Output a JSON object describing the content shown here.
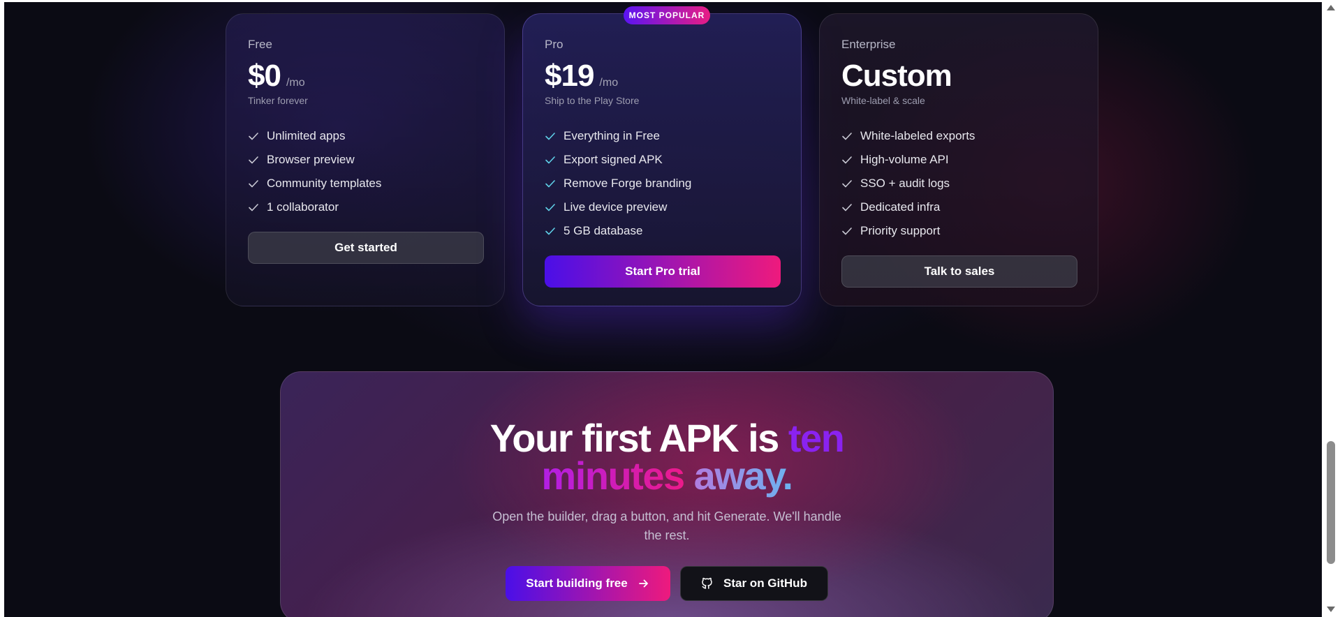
{
  "pricing": {
    "plans": [
      {
        "name": "Free",
        "price": "$0",
        "period": "/mo",
        "subtitle": "Tinker forever",
        "features": [
          "Unlimited apps",
          "Browser preview",
          "Community templates",
          "1 collaborator"
        ],
        "cta": "Get started"
      },
      {
        "name": "Pro",
        "badge": "MOST POPULAR",
        "price": "$19",
        "period": "/mo",
        "subtitle": "Ship to the Play Store",
        "features": [
          "Everything in Free",
          "Export signed APK",
          "Remove Forge branding",
          "Live device preview",
          "5 GB database"
        ],
        "cta": "Start Pro trial"
      },
      {
        "name": "Enterprise",
        "price": "Custom",
        "subtitle": "White-label & scale",
        "features": [
          "White-labeled exports",
          "High-volume API",
          "SSO + audit logs",
          "Dedicated infra",
          "Priority support"
        ],
        "cta": "Talk to sales"
      }
    ]
  },
  "cta": {
    "heading_start": "Your first APK is",
    "heading_ten": "ten",
    "heading_minutes": "minutes",
    "heading_away": "away.",
    "subtext": "Open the builder, drag a button, and hit Generate. We'll handle the rest.",
    "primary_button": "Start building free",
    "secondary_button": "Star on GitHub"
  },
  "icons": {
    "feature_check": "check-icon",
    "primary_button_icon": "arrow-right-icon",
    "secondary_button_icon": "github-icon"
  },
  "colors": {
    "accent_start": "#4a0fe8",
    "accent_end": "#ee1a7d",
    "check_free": "#c9c9d4",
    "check_pro": "#5fd0e8",
    "background": "#0b0b14"
  }
}
